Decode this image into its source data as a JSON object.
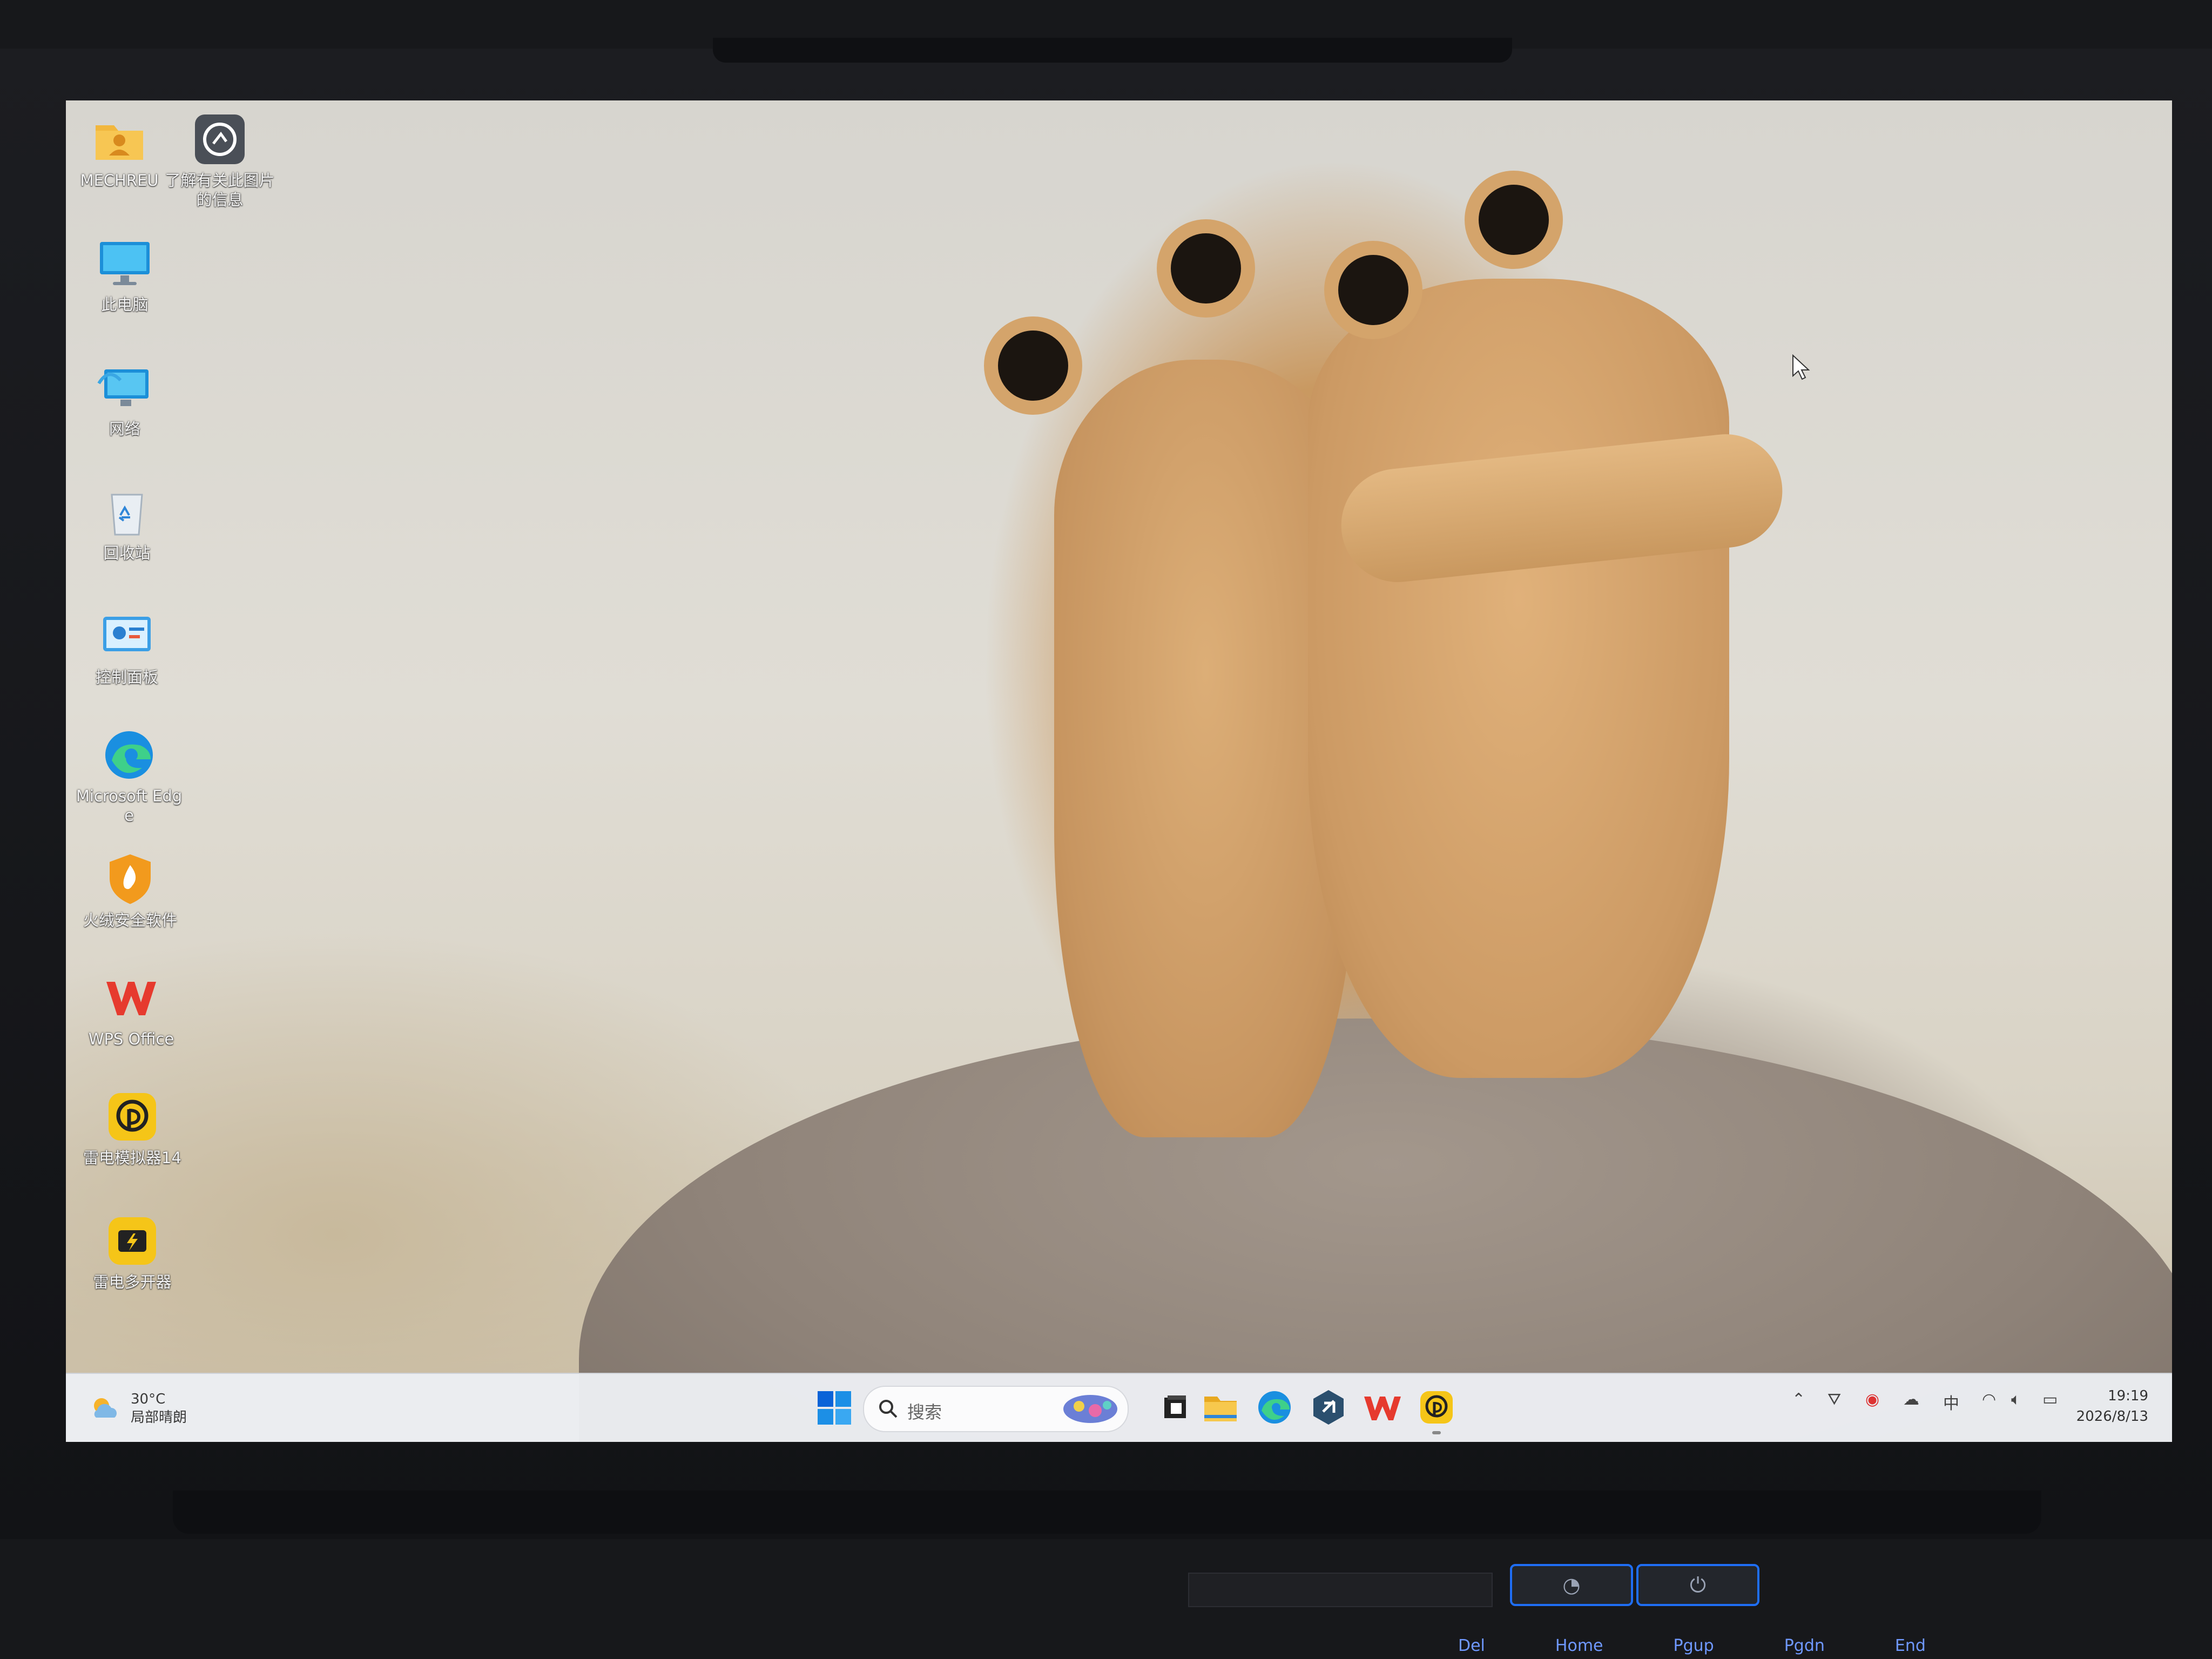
{
  "desktop": {
    "icons": [
      {
        "id": "mechreu",
        "label": "MECHREU",
        "icon": "user-folder-icon"
      },
      {
        "id": "learn-picture",
        "label": "了解有关此图片的信息",
        "icon": "camera-info-icon"
      },
      {
        "id": "this-pc",
        "label": "此电脑",
        "icon": "monitor-icon"
      },
      {
        "id": "network",
        "label": "网络",
        "icon": "network-icon"
      },
      {
        "id": "recycle-bin",
        "label": "回收站",
        "icon": "recycle-bin-icon"
      },
      {
        "id": "control-panel",
        "label": "控制面板",
        "icon": "control-panel-icon"
      },
      {
        "id": "edge",
        "label": "Microsoft Edge",
        "icon": "edge-icon"
      },
      {
        "id": "huorong",
        "label": "火绒安全软件",
        "icon": "flame-shield-icon"
      },
      {
        "id": "wps",
        "label": "WPS Office",
        "icon": "wps-icon"
      },
      {
        "id": "ldplayer",
        "label": "雷电模拟器14",
        "icon": "ldplayer-icon"
      },
      {
        "id": "ldmulti",
        "label": "雷电多开器",
        "icon": "ldmulti-icon"
      }
    ]
  },
  "taskbar": {
    "weather": {
      "temp": "30°C",
      "desc": "局部晴朗"
    },
    "search_placeholder": "搜索",
    "ime": "中",
    "time": "19:19",
    "date": "2026/8/13"
  },
  "hardware": {
    "label_plate": "",
    "keys": [
      "Del",
      "Home",
      "Pgup",
      "Pgdn",
      "End"
    ]
  },
  "colors": {
    "accent": "#0a63d8",
    "edge_blue": "#1a8fe0",
    "wps_red": "#e63a2e",
    "ld_yellow": "#f5c518"
  }
}
